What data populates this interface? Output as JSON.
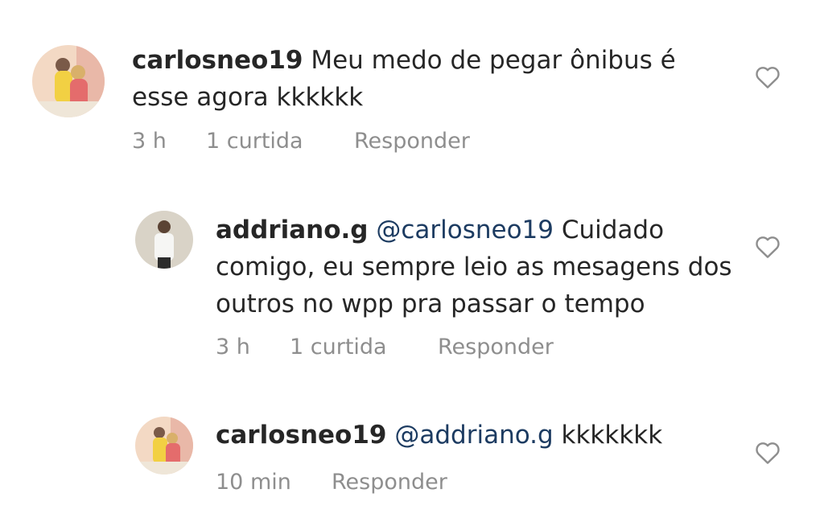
{
  "comments": [
    {
      "username": "carlosneo19",
      "text": "Meu medo de pegar ônibus é esse agora kkkkkk",
      "time": "3 h",
      "likes": "1 curtida",
      "reply_label": "Responder"
    },
    {
      "username": "addriano.g",
      "mention": "@carlosneo19",
      "text": "Cuidado comigo, eu sempre leio as mesagens dos outros no wpp pra passar o tempo",
      "time": "3 h",
      "likes": "1 curtida",
      "reply_label": "Responder"
    },
    {
      "username": "carlosneo19",
      "mention": "@addriano.g",
      "text": "kkkkkkk",
      "time": "10 min",
      "reply_label": "Responder"
    }
  ],
  "icons": {
    "like": "heart-outline-icon",
    "avatar": "avatar-photo"
  },
  "colors": {
    "text": "#262626",
    "meta": "#8e8e8e",
    "mention": "#1c3b61"
  }
}
